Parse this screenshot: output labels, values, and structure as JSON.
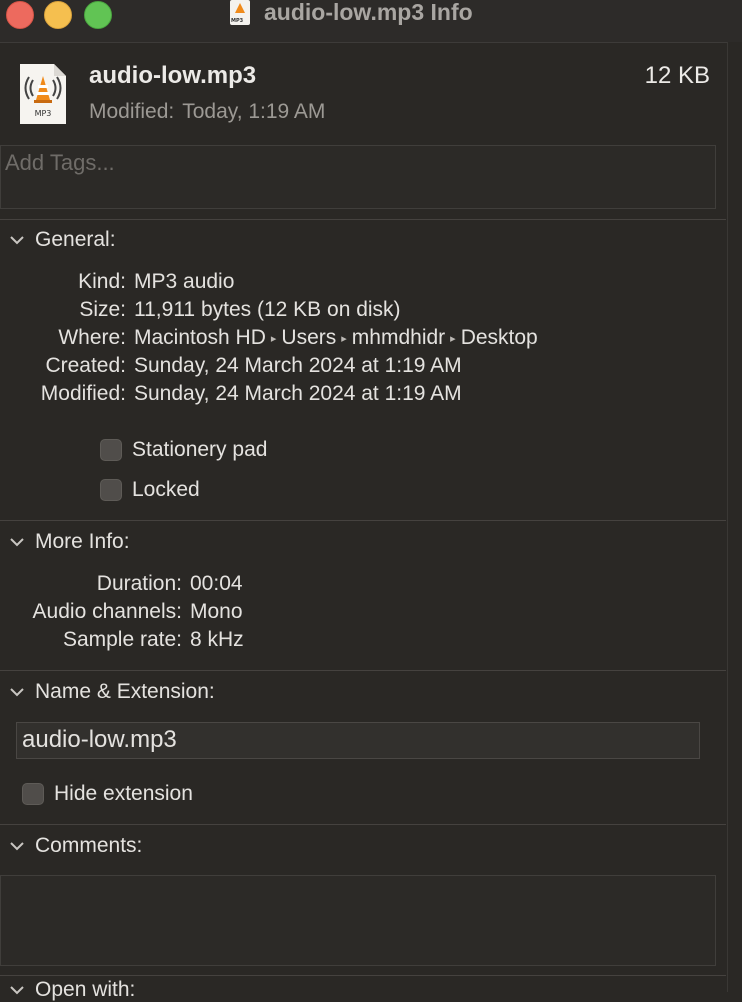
{
  "window": {
    "title": "audio-low.mp3 Info"
  },
  "header": {
    "name": "audio-low.mp3",
    "size": "12 KB",
    "modified_label": "Modified:",
    "modified_value": "Today, 1:19 AM",
    "icon_label": "MP3"
  },
  "tags": {
    "placeholder": "Add Tags..."
  },
  "general": {
    "title": "General:",
    "kind_label": "Kind:",
    "kind": "MP3 audio",
    "size_label": "Size:",
    "size": "11,911 bytes (12 KB on disk)",
    "where_label": "Where:",
    "where_path": [
      "Macintosh HD",
      "Users",
      "mhmdhidr",
      "Desktop"
    ],
    "path_separator": "▸",
    "created_label": "Created:",
    "created": "Sunday, 24 March 2024 at 1:19 AM",
    "modified_label": "Modified:",
    "modified": "Sunday, 24 March 2024 at 1:19 AM",
    "stationery_label": "Stationery pad",
    "locked_label": "Locked"
  },
  "more_info": {
    "title": "More Info:",
    "duration_label": "Duration:",
    "duration": "00:04",
    "channels_label": "Audio channels:",
    "channels": "Mono",
    "sample_label": "Sample rate:",
    "sample": "8 kHz"
  },
  "name_ext": {
    "title": "Name & Extension:",
    "value": "audio-low.mp3",
    "hide_label": "Hide extension"
  },
  "comments": {
    "title": "Comments:"
  },
  "open_with": {
    "title": "Open with:"
  }
}
